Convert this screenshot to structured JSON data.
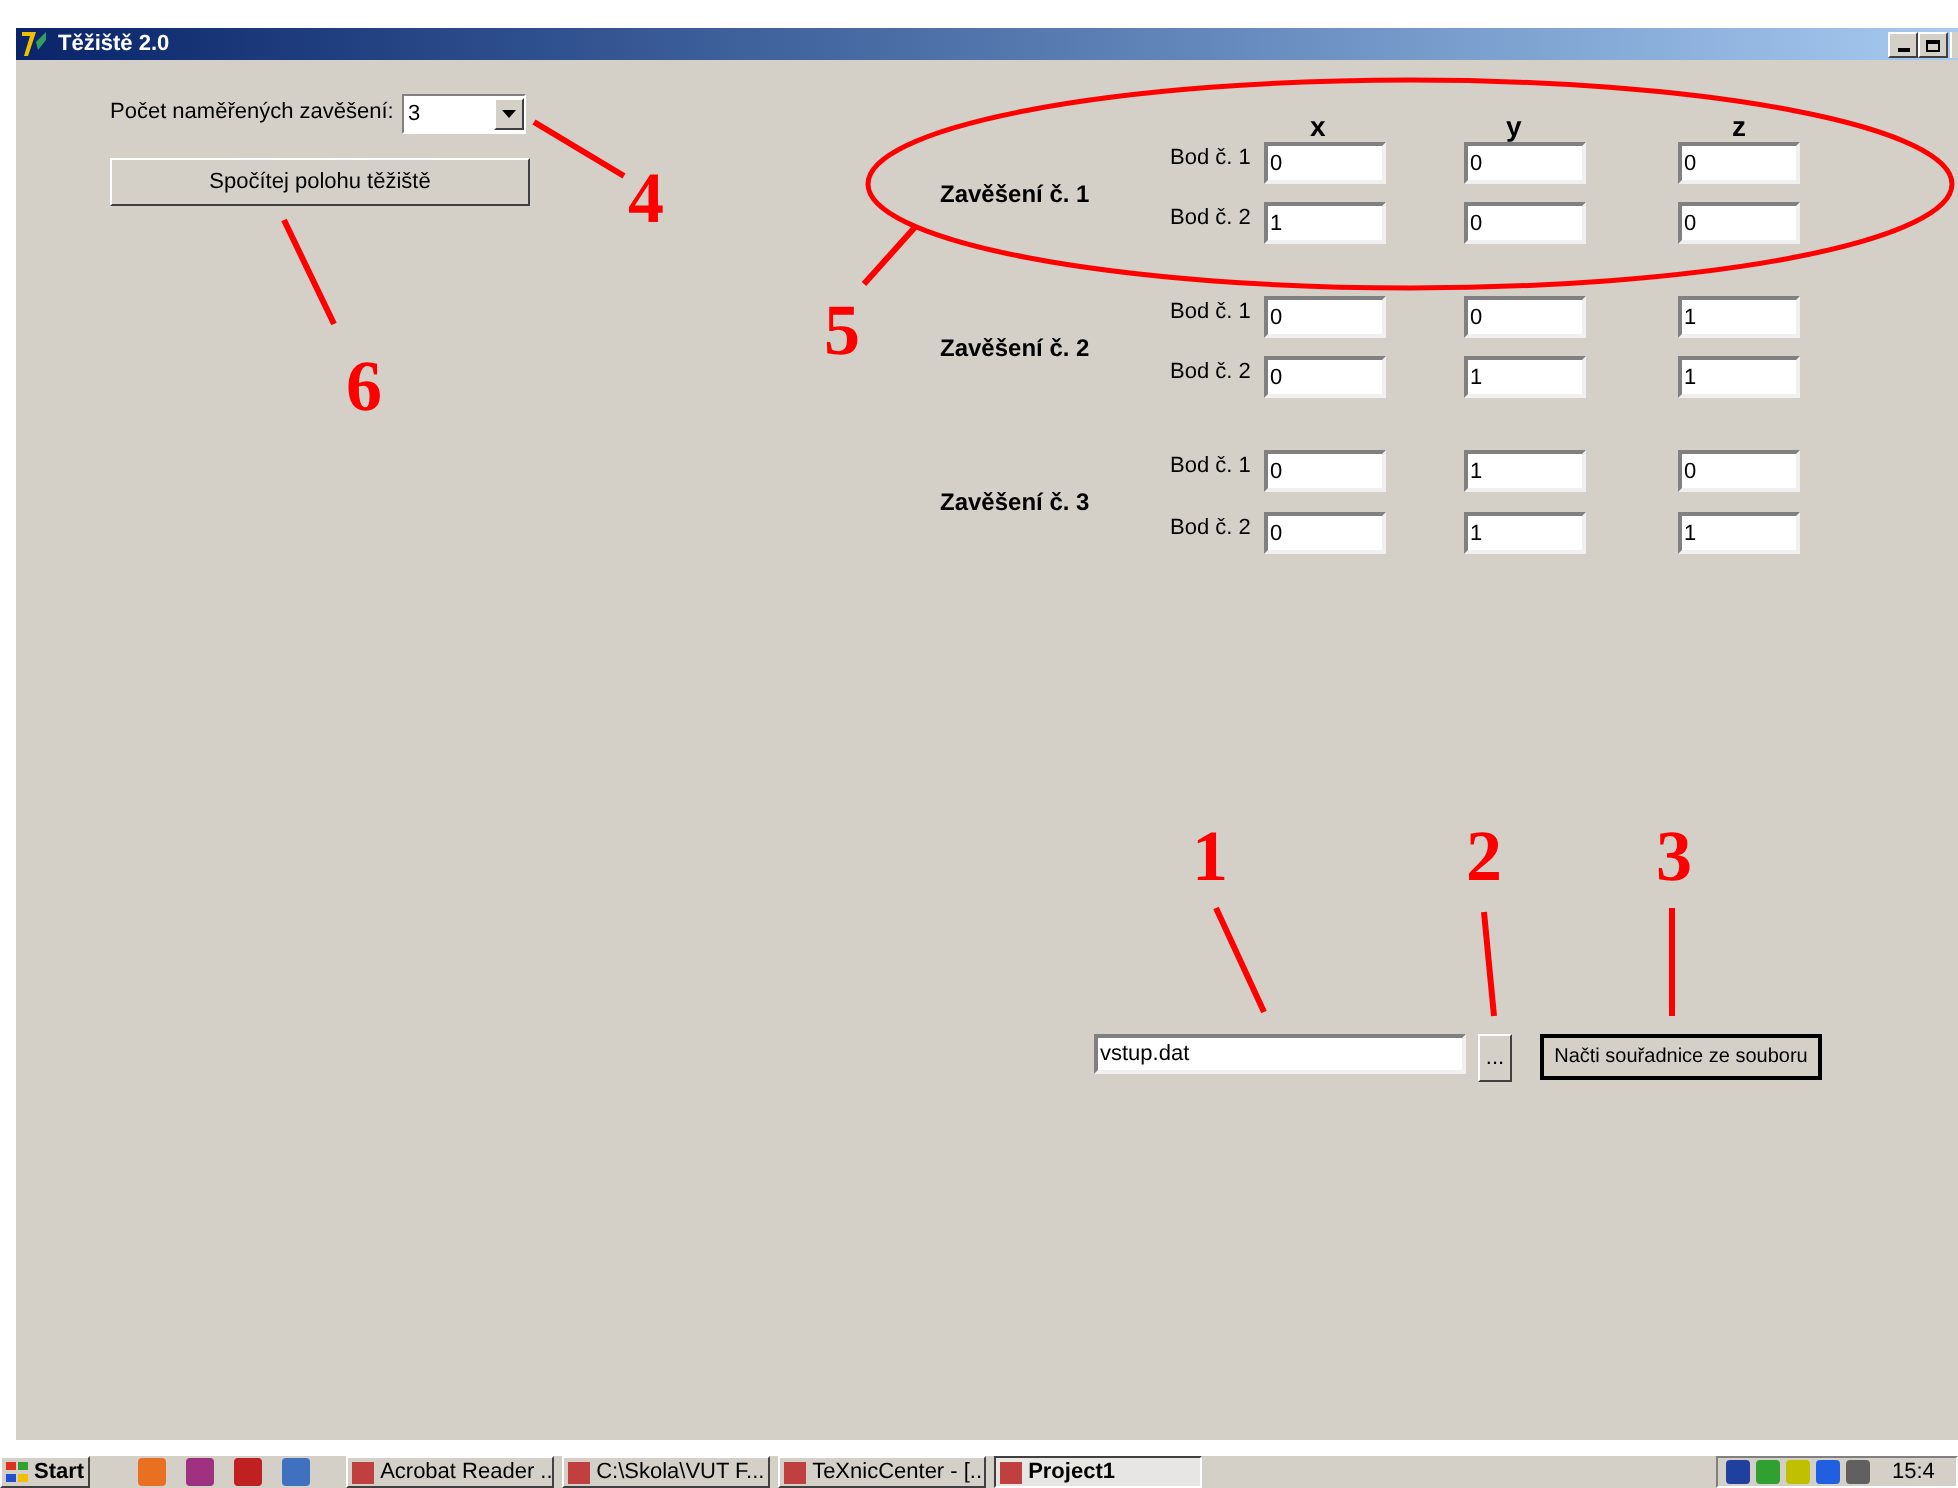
{
  "window": {
    "title": "Těžiště 2.0"
  },
  "count_label": "Počet naměřených zavěšení:",
  "count_combo": {
    "value": "3"
  },
  "compute_button": "Spočítej polohu těžiště",
  "columns": [
    "x",
    "y",
    "z"
  ],
  "suspensions": [
    {
      "label": "Zavěšení č. 1",
      "points": [
        {
          "label": "Bod č. 1",
          "values": [
            "0",
            "0",
            "0"
          ]
        },
        {
          "label": "Bod č. 2",
          "values": [
            "1",
            "0",
            "0"
          ]
        }
      ]
    },
    {
      "label": "Zavěšení č. 2",
      "points": [
        {
          "label": "Bod č. 1",
          "values": [
            "0",
            "0",
            "1"
          ]
        },
        {
          "label": "Bod č. 2",
          "values": [
            "0",
            "1",
            "1"
          ]
        }
      ]
    },
    {
      "label": "Zavěšení č. 3",
      "points": [
        {
          "label": "Bod č. 1",
          "values": [
            "0",
            "1",
            "0"
          ]
        },
        {
          "label": "Bod č. 2",
          "values": [
            "0",
            "1",
            "1"
          ]
        }
      ]
    }
  ],
  "file_field": {
    "value": "vstup.dat"
  },
  "browse_button": "...",
  "load_button": "Načti souřadnice ze souboru",
  "annotations": [
    {
      "label": "1"
    },
    {
      "label": "2"
    },
    {
      "label": "3"
    },
    {
      "label": "4"
    },
    {
      "label": "5"
    },
    {
      "label": "6"
    }
  ],
  "taskbar": {
    "start": "Start",
    "tasks": [
      {
        "label": "Acrobat Reader ...",
        "selected": false
      },
      {
        "label": "C:\\Skola\\VUT F...",
        "selected": false
      },
      {
        "label": "TeXnicCenter - [...",
        "selected": false
      },
      {
        "label": "Project1",
        "selected": true
      }
    ],
    "clock": "15:4"
  }
}
